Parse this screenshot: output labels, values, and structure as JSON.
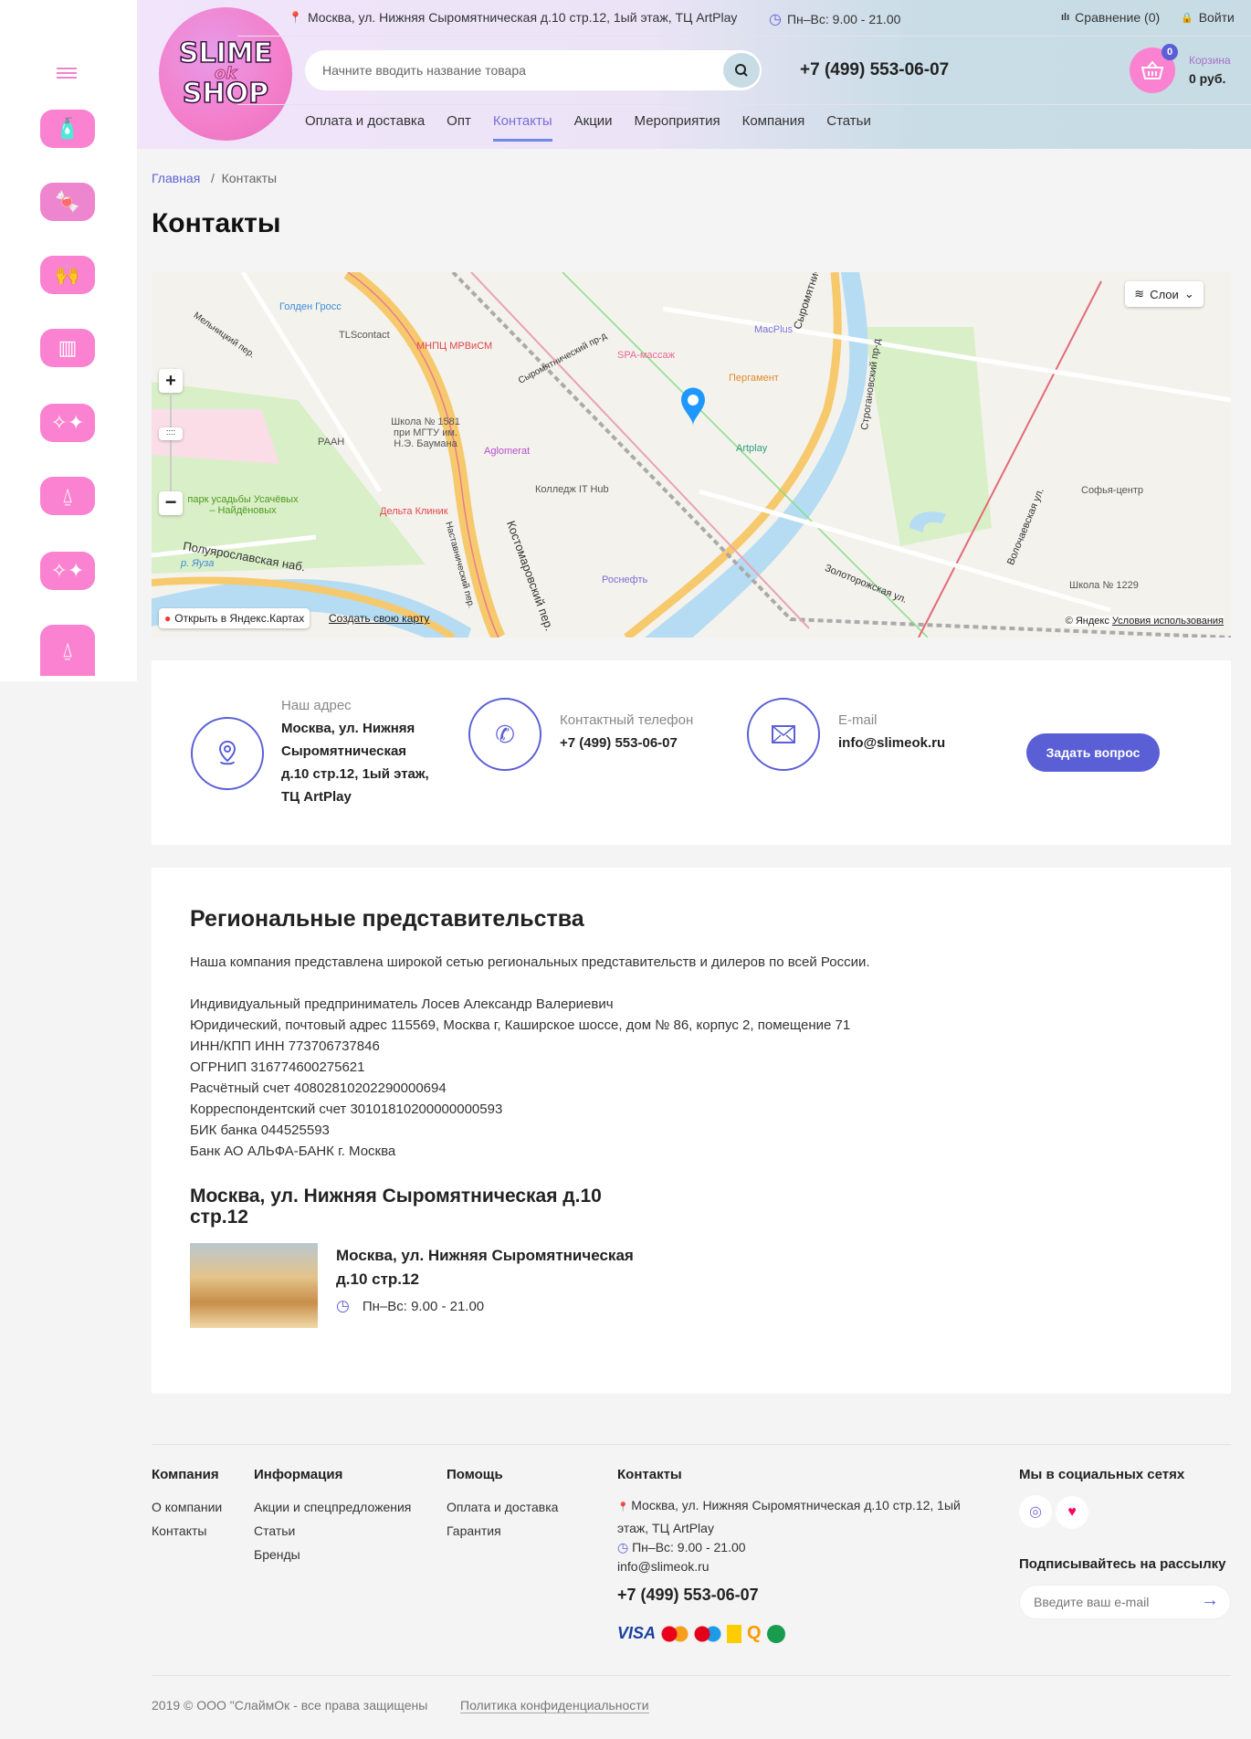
{
  "sidebar": {
    "categories": [
      {
        "icon": "glue-bottle-icon"
      },
      {
        "icon": "candies-icon"
      },
      {
        "icon": "hands-slime-icon"
      },
      {
        "icon": "dripping-slime-icon"
      },
      {
        "icon": "sparkles-icon"
      },
      {
        "icon": "slime-bottle-icon"
      },
      {
        "icon": "sparkles-icon"
      },
      {
        "icon": "slime-bottle-icon"
      }
    ]
  },
  "header": {
    "logo_text": [
      "SLIME",
      "ok",
      "SHOP"
    ],
    "address": "Москва, ул. Нижняя Сыромятническая д.10 стр.12, 1ый этаж, ТЦ ArtPlay",
    "hours": "Пн–Вс: 9.00 - 21.00",
    "compare": "Сравнение (0)",
    "login": "Войти",
    "search_placeholder": "Начните вводить название товара",
    "phone": "+7 (499) 553-06-07",
    "cart_count": "0",
    "cart_label": "Корзина",
    "cart_total": "0 руб.",
    "nav": [
      "Оплата и доставка",
      "Опт",
      "Контакты",
      "Акции",
      "Мероприятия",
      "Компания",
      "Статьи"
    ]
  },
  "breadcrumb": {
    "home": "Главная",
    "sep": "/",
    "current": "Контакты"
  },
  "page_title": "Контакты",
  "map": {
    "layers": "Слои",
    "open": "Открыть в Яндекс.Картах",
    "create": "Создать свою карту",
    "copyright": "© Яндекс",
    "terms": "Условия использования",
    "labels": [
      "Голден Гросс",
      "TLScontact",
      "МНПЦ МРВиСМ",
      "SPA-массаж",
      "MacPlus",
      "Пергамент",
      "Artplay",
      "Школа № 1581 при МГТУ им. Н.Э. Баумана",
      "РААН",
      "Aglomerat",
      "Колледж IT Hub",
      "Дельта Клиник",
      "парк усадьбы Усачёвых – Найдёновых",
      "Роснефть",
      "Софья-центр",
      "Школа № 1229",
      "Сыромятническая наб.",
      "Строгановский пр-д",
      "Золоторожская ул.",
      "Волочаевская ул.",
      "Костомаровский пер.",
      "Наставнический пер.",
      "Сыромятнический пр-д",
      "Мельницкий пер.",
      "р. Яуза",
      "Полуярославская наб."
    ]
  },
  "contacts": {
    "address_label": "Наш адрес",
    "address": "Москва, ул. Нижняя Сыромятническая д.10 стр.12, 1ый этаж, ТЦ ArtPlay",
    "phone_label": "Контактный телефон",
    "phone": "+7 (499) 553-06-07",
    "email_label": "E-mail",
    "email": "info@slimeok.ru",
    "ask_button": "Задать вопрос"
  },
  "regional": {
    "title": "Региональные представительства",
    "intro": "Наша компания представлена широкой сетью региональных представительств и дилеров по всей России.",
    "details": [
      "Индивидуальный предприниматель Лосев Александр Валериевич",
      "Юридический, почтовый адрес 115569, Москва г, Каширское шоссе, дом № 86, корпус 2, помещение 71",
      "ИНН/КПП ИНН 773706737846",
      "ОГРНИП 316774600275621",
      "Расчётный счет 40802810202290000694",
      "Корреспондентский счет 30101810200000000593",
      "БИК банка 044525593",
      "Банк АО АЛЬФА-БАНК г. Москва"
    ],
    "store_heading": "Москва, ул. Нижняя Сыромятническая д.10 стр.12",
    "store_name": "Москва, ул. Нижняя Сыромятническая д.10 стр.12",
    "store_hours": "Пн–Вс: 9.00 - 21.00"
  },
  "footer": {
    "company": {
      "title": "Компания",
      "links": [
        "О компании",
        "Контакты"
      ]
    },
    "info": {
      "title": "Информация",
      "links": [
        "Акции и спецпредложения",
        "Статьи",
        "Бренды"
      ]
    },
    "help": {
      "title": "Помощь",
      "links": [
        "Оплата и доставка",
        "Гарантия"
      ]
    },
    "contacts": {
      "title": "Контакты",
      "address": "Москва, ул. Нижняя Сыромятническая д.10 стр.12, 1ый этаж, ТЦ ArtPlay",
      "hours": "Пн–Вс: 9.00 - 21.00",
      "email": "info@slimeok.ru",
      "phone": "+7 (499) 553-06-07"
    },
    "payments": [
      "VISA",
      "mastercard",
      "maestro",
      "yandex-money",
      "qiwi",
      "sberbank"
    ],
    "social_title": "Мы в социальных сетях",
    "subscribe_title": "Подписывайтесь на рассылку",
    "email_placeholder": "Введите ваш e-mail",
    "copyright": "2019 © ООО \"СлаймОк - все права защищены",
    "privacy": "Политика конфиденциальности"
  },
  "colors": {
    "accent": "#5b5fd6",
    "pink": "#fa82d0",
    "bg": "#f4f4f4"
  }
}
